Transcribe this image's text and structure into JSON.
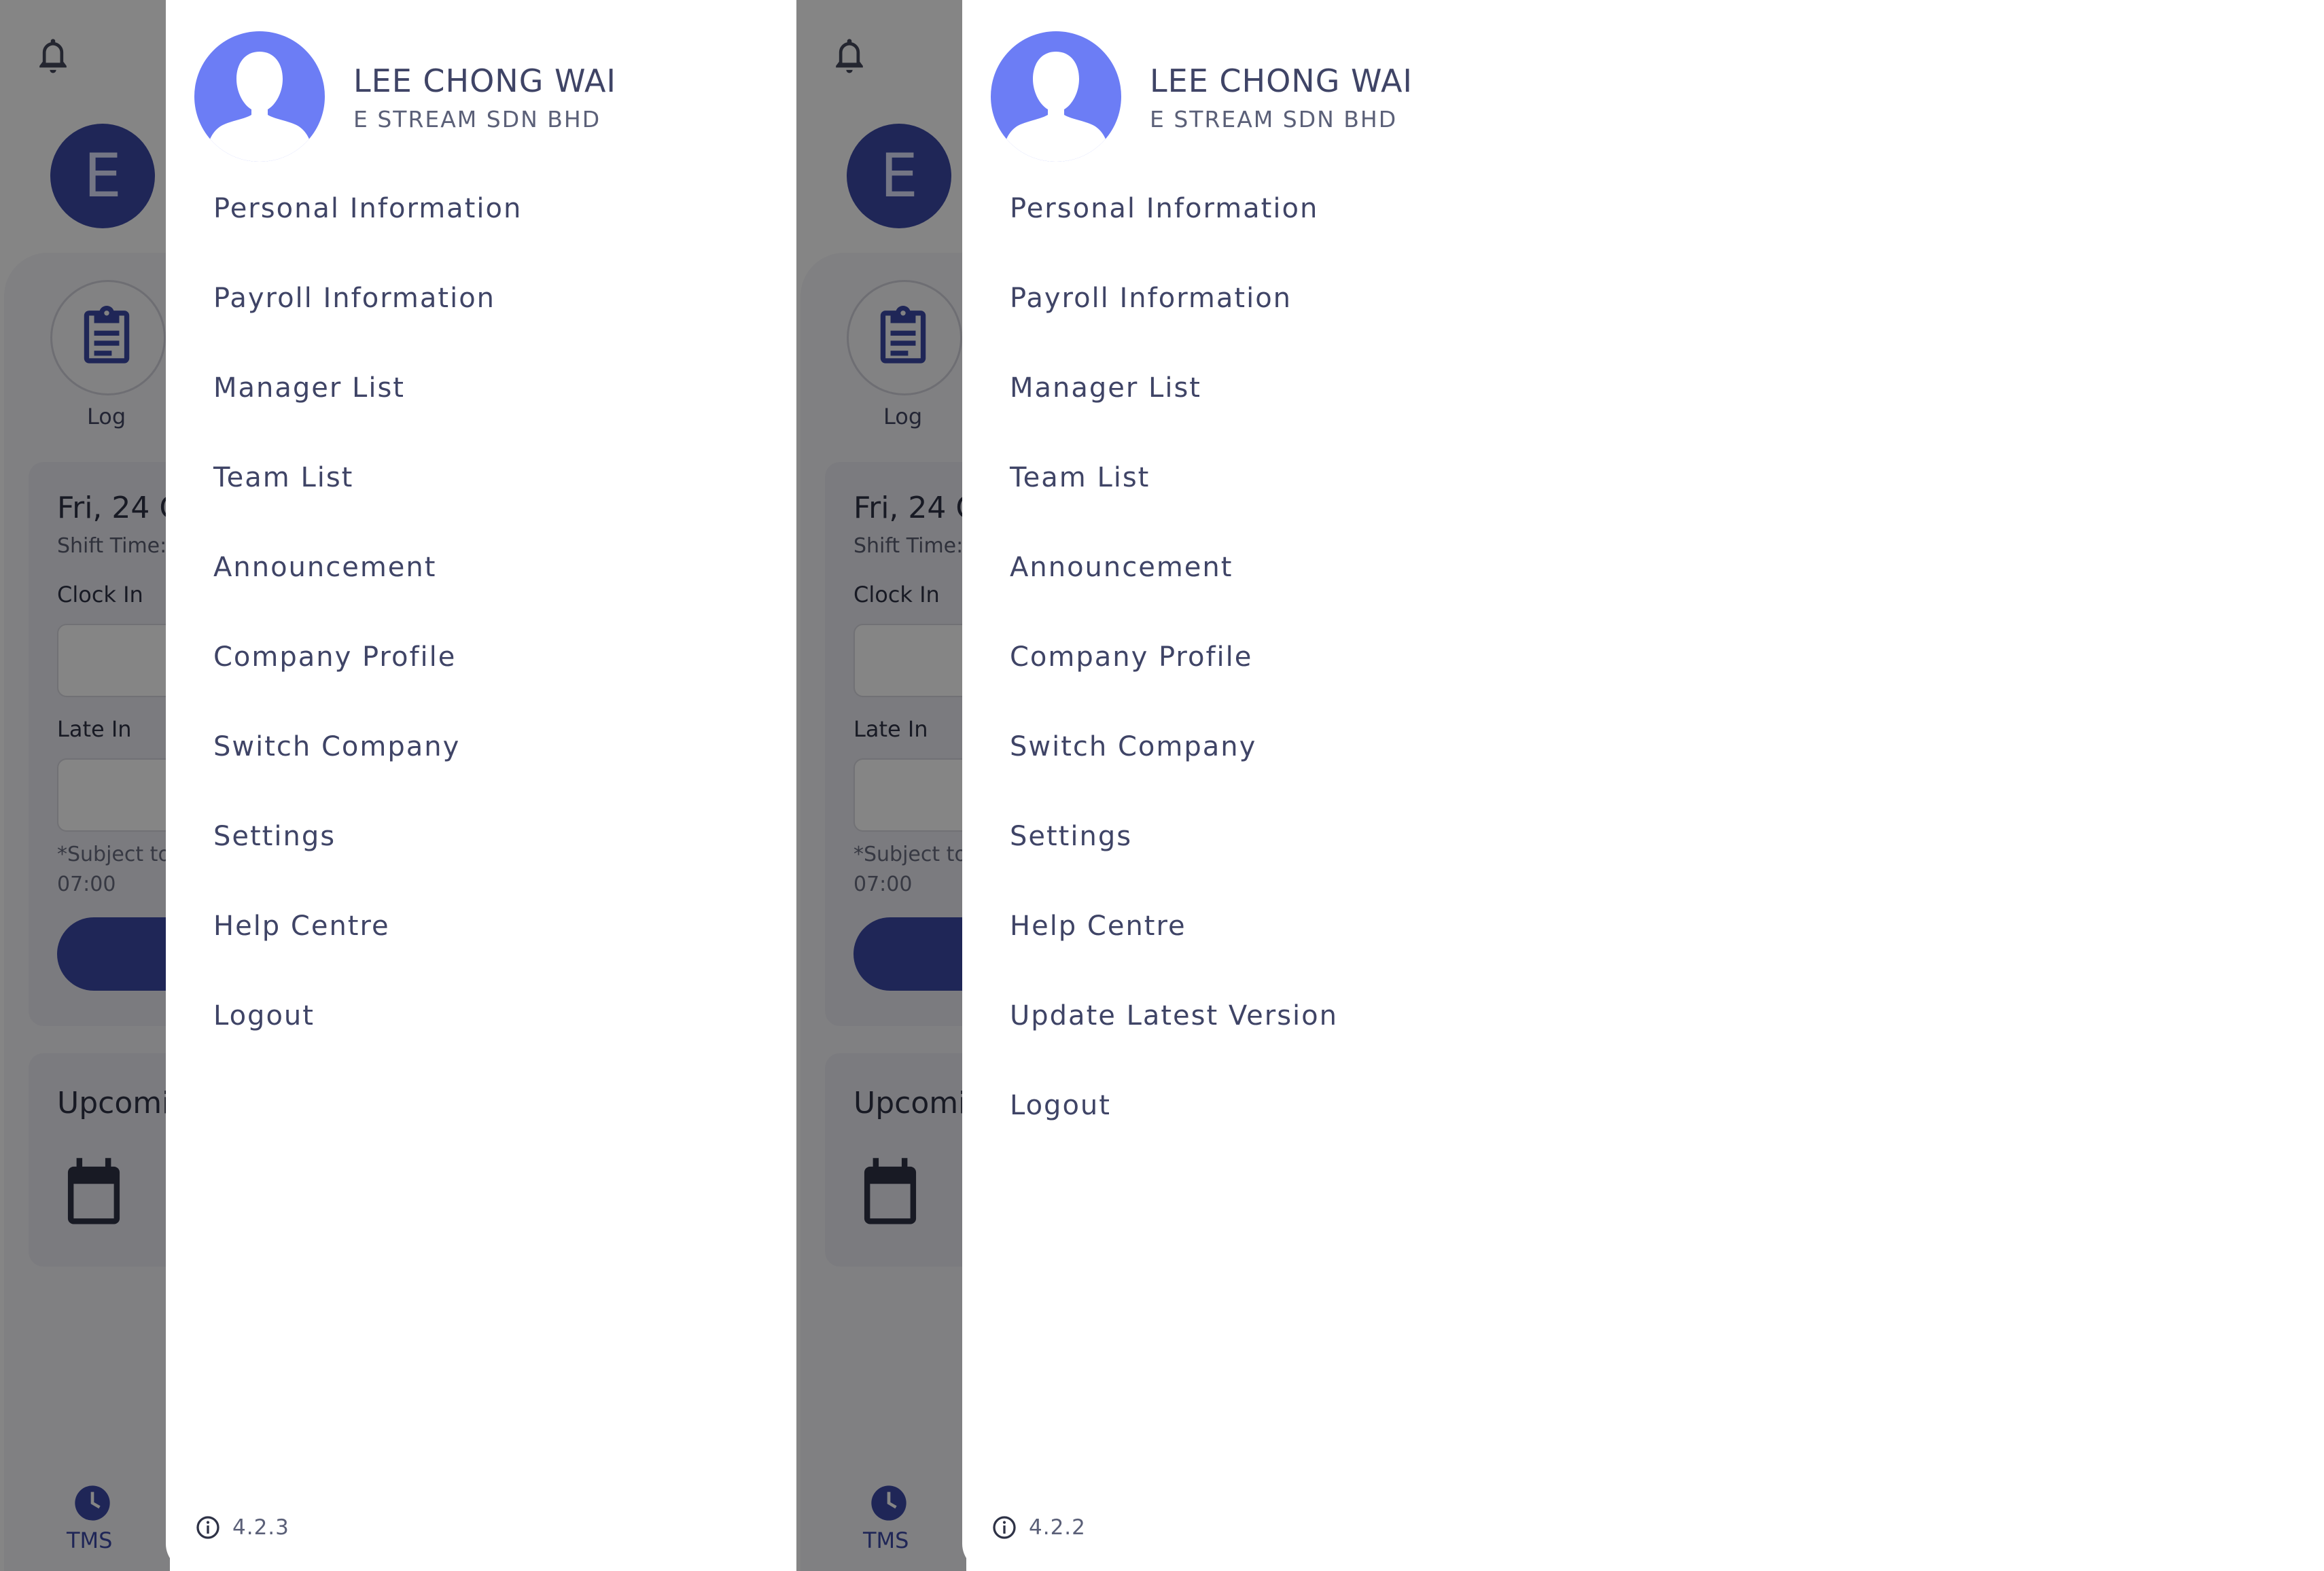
{
  "screens": [
    {
      "background": {
        "avatar_letter": "E",
        "log_label": "Log",
        "date": "Fri, 24 O",
        "shift_time_label": "Shift Time:",
        "clock_in_label": "Clock In",
        "late_in_label": "Late In",
        "subject_note_line1": "*Subject to",
        "subject_note_line2": "07:00",
        "upcoming_title": "Upcomi",
        "bottom_nav_label": "TMS"
      },
      "drawer": {
        "user_name": "LEE CHONG WAI",
        "company": "E STREAM SDN BHD",
        "menu": [
          "Personal Information",
          "Payroll Information",
          "Manager List",
          "Team List",
          "Announcement",
          "Company Profile",
          "Switch Company",
          "Settings",
          "Help Centre",
          "Logout"
        ],
        "version": "4.2.3"
      }
    },
    {
      "background": {
        "avatar_letter": "E",
        "log_label": "Log",
        "date": "Fri, 24 O",
        "shift_time_label": "Shift Time:",
        "clock_in_label": "Clock In",
        "late_in_label": "Late In",
        "subject_note_line1": "*Subject to",
        "subject_note_line2": "07:00",
        "upcoming_title": "Upcomi",
        "bottom_nav_label": "TMS"
      },
      "drawer": {
        "user_name": "LEE CHONG WAI",
        "company": "E STREAM SDN BHD",
        "menu": [
          "Personal Information",
          "Payroll Information",
          "Manager List",
          "Team List",
          "Announcement",
          "Company Profile",
          "Switch Company",
          "Settings",
          "Help Centre",
          "Update Latest Version",
          "Logout"
        ],
        "version": "4.2.2"
      }
    }
  ],
  "colors": {
    "primary": "#3d4aa8",
    "avatar": "#6c7df5",
    "text": "#3f4466",
    "scrim": "rgba(0,0,0,0.48)"
  },
  "icons": [
    "bell-icon",
    "clipboard-icon",
    "calendar-icon",
    "clock-icon",
    "avatar-placeholder-icon",
    "info-icon"
  ]
}
